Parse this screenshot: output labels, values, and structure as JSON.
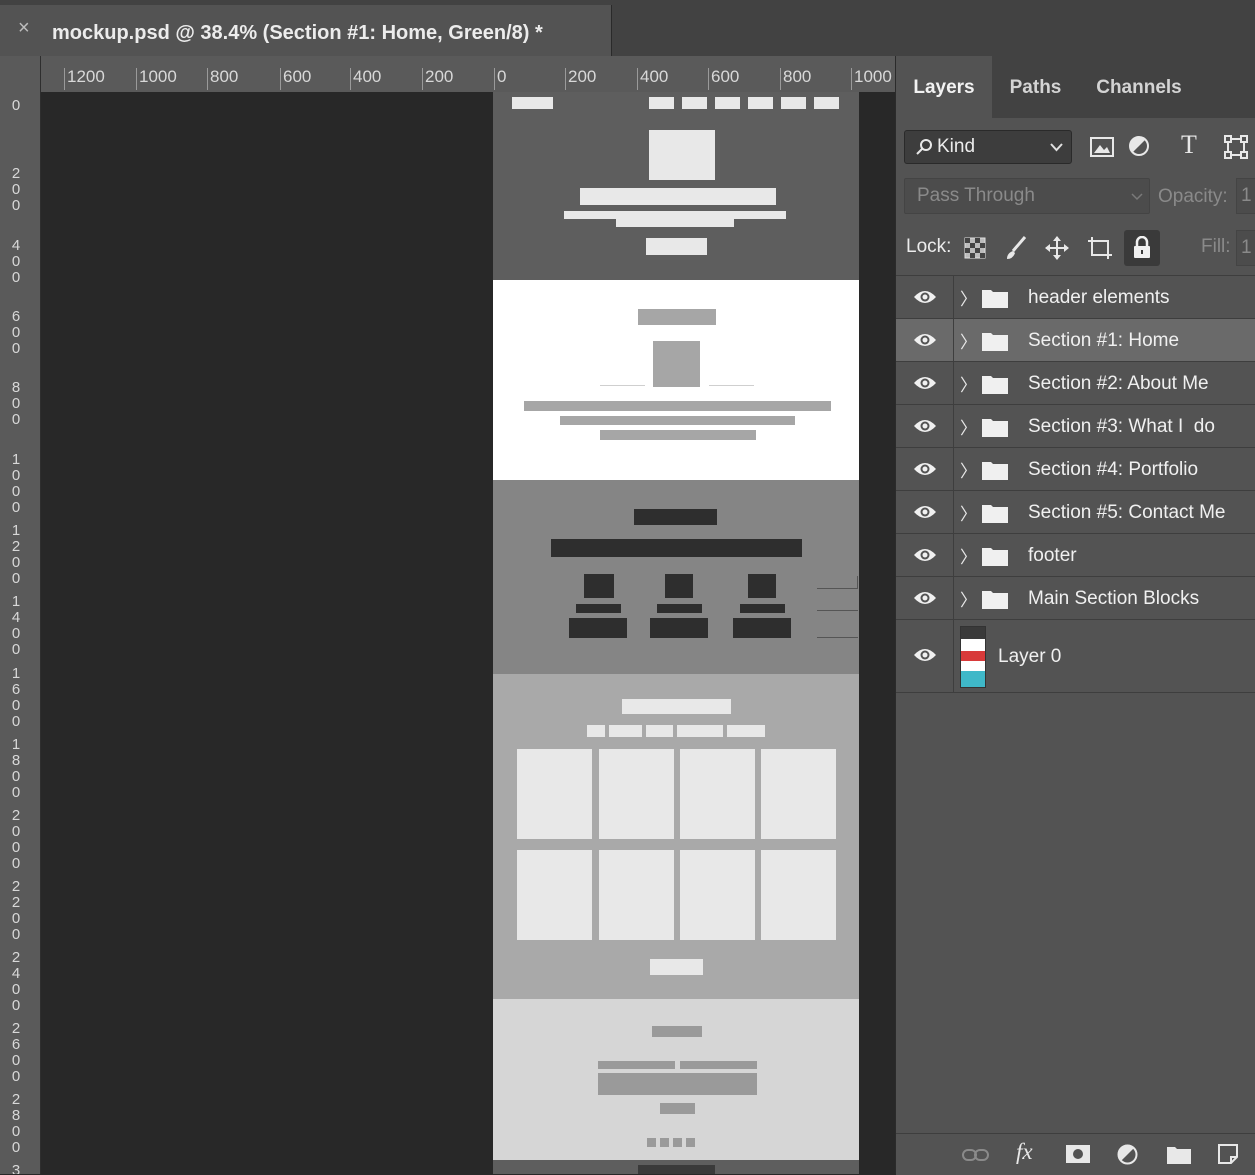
{
  "document_tab": {
    "close_symbol": "×",
    "title": "mockup.psd @ 38.4% (Section #1: Home, Green/8) *"
  },
  "rulers": {
    "horizontal": [
      "1200",
      "1000",
      "800",
      "600",
      "400",
      "200",
      "0",
      "200",
      "400",
      "600",
      "800",
      "1000"
    ],
    "vertical": [
      "0",
      "200",
      "400",
      "600",
      "800",
      "1000",
      "1200",
      "1400",
      "1600",
      "1800",
      "2000",
      "2200",
      "2400",
      "2600",
      "2800",
      "3"
    ]
  },
  "panel": {
    "tabs": [
      "Layers",
      "Paths",
      "Channels"
    ],
    "active_tab": "Layers",
    "filter": {
      "kind_label": "Kind",
      "icons": [
        "image-filter-icon",
        "adjustment-filter-icon",
        "type-filter-icon",
        "shape-filter-icon"
      ]
    },
    "blend_mode": "Pass Through",
    "opacity_label": "Opacity:",
    "opacity_value": "1",
    "lock_label": "Lock:",
    "fill_label": "Fill:",
    "fill_value": "1",
    "layers": [
      {
        "name": "header elements",
        "type": "group",
        "selected": false
      },
      {
        "name": "Section #1: Home",
        "type": "group",
        "selected": true
      },
      {
        "name": "Section #2: About Me",
        "type": "group",
        "selected": false
      },
      {
        "name": "Section #3: What I  do",
        "type": "group",
        "selected": false
      },
      {
        "name": "Section #4: Portfolio",
        "type": "group",
        "selected": false
      },
      {
        "name": "Section #5: Contact Me",
        "type": "group",
        "selected": false
      },
      {
        "name": "footer",
        "type": "group",
        "selected": false
      },
      {
        "name": "Main Section Blocks",
        "type": "group",
        "selected": false
      },
      {
        "name": "Layer 0",
        "type": "image",
        "selected": false
      }
    ],
    "bottom_icons": [
      "link-icon",
      "fx-icon",
      "mask-icon",
      "adjustment-icon",
      "new-group-icon",
      "new-layer-icon"
    ],
    "fx_label": "fx"
  },
  "colors": {
    "app_background": "#282828",
    "panel": "#535353",
    "selected_row": "#6a6a6a",
    "section1": "#5e5e5e",
    "section2": "#ffffff",
    "section3": "#858585",
    "section4": "#a9a9a9",
    "section5": "#d6d6d6"
  }
}
